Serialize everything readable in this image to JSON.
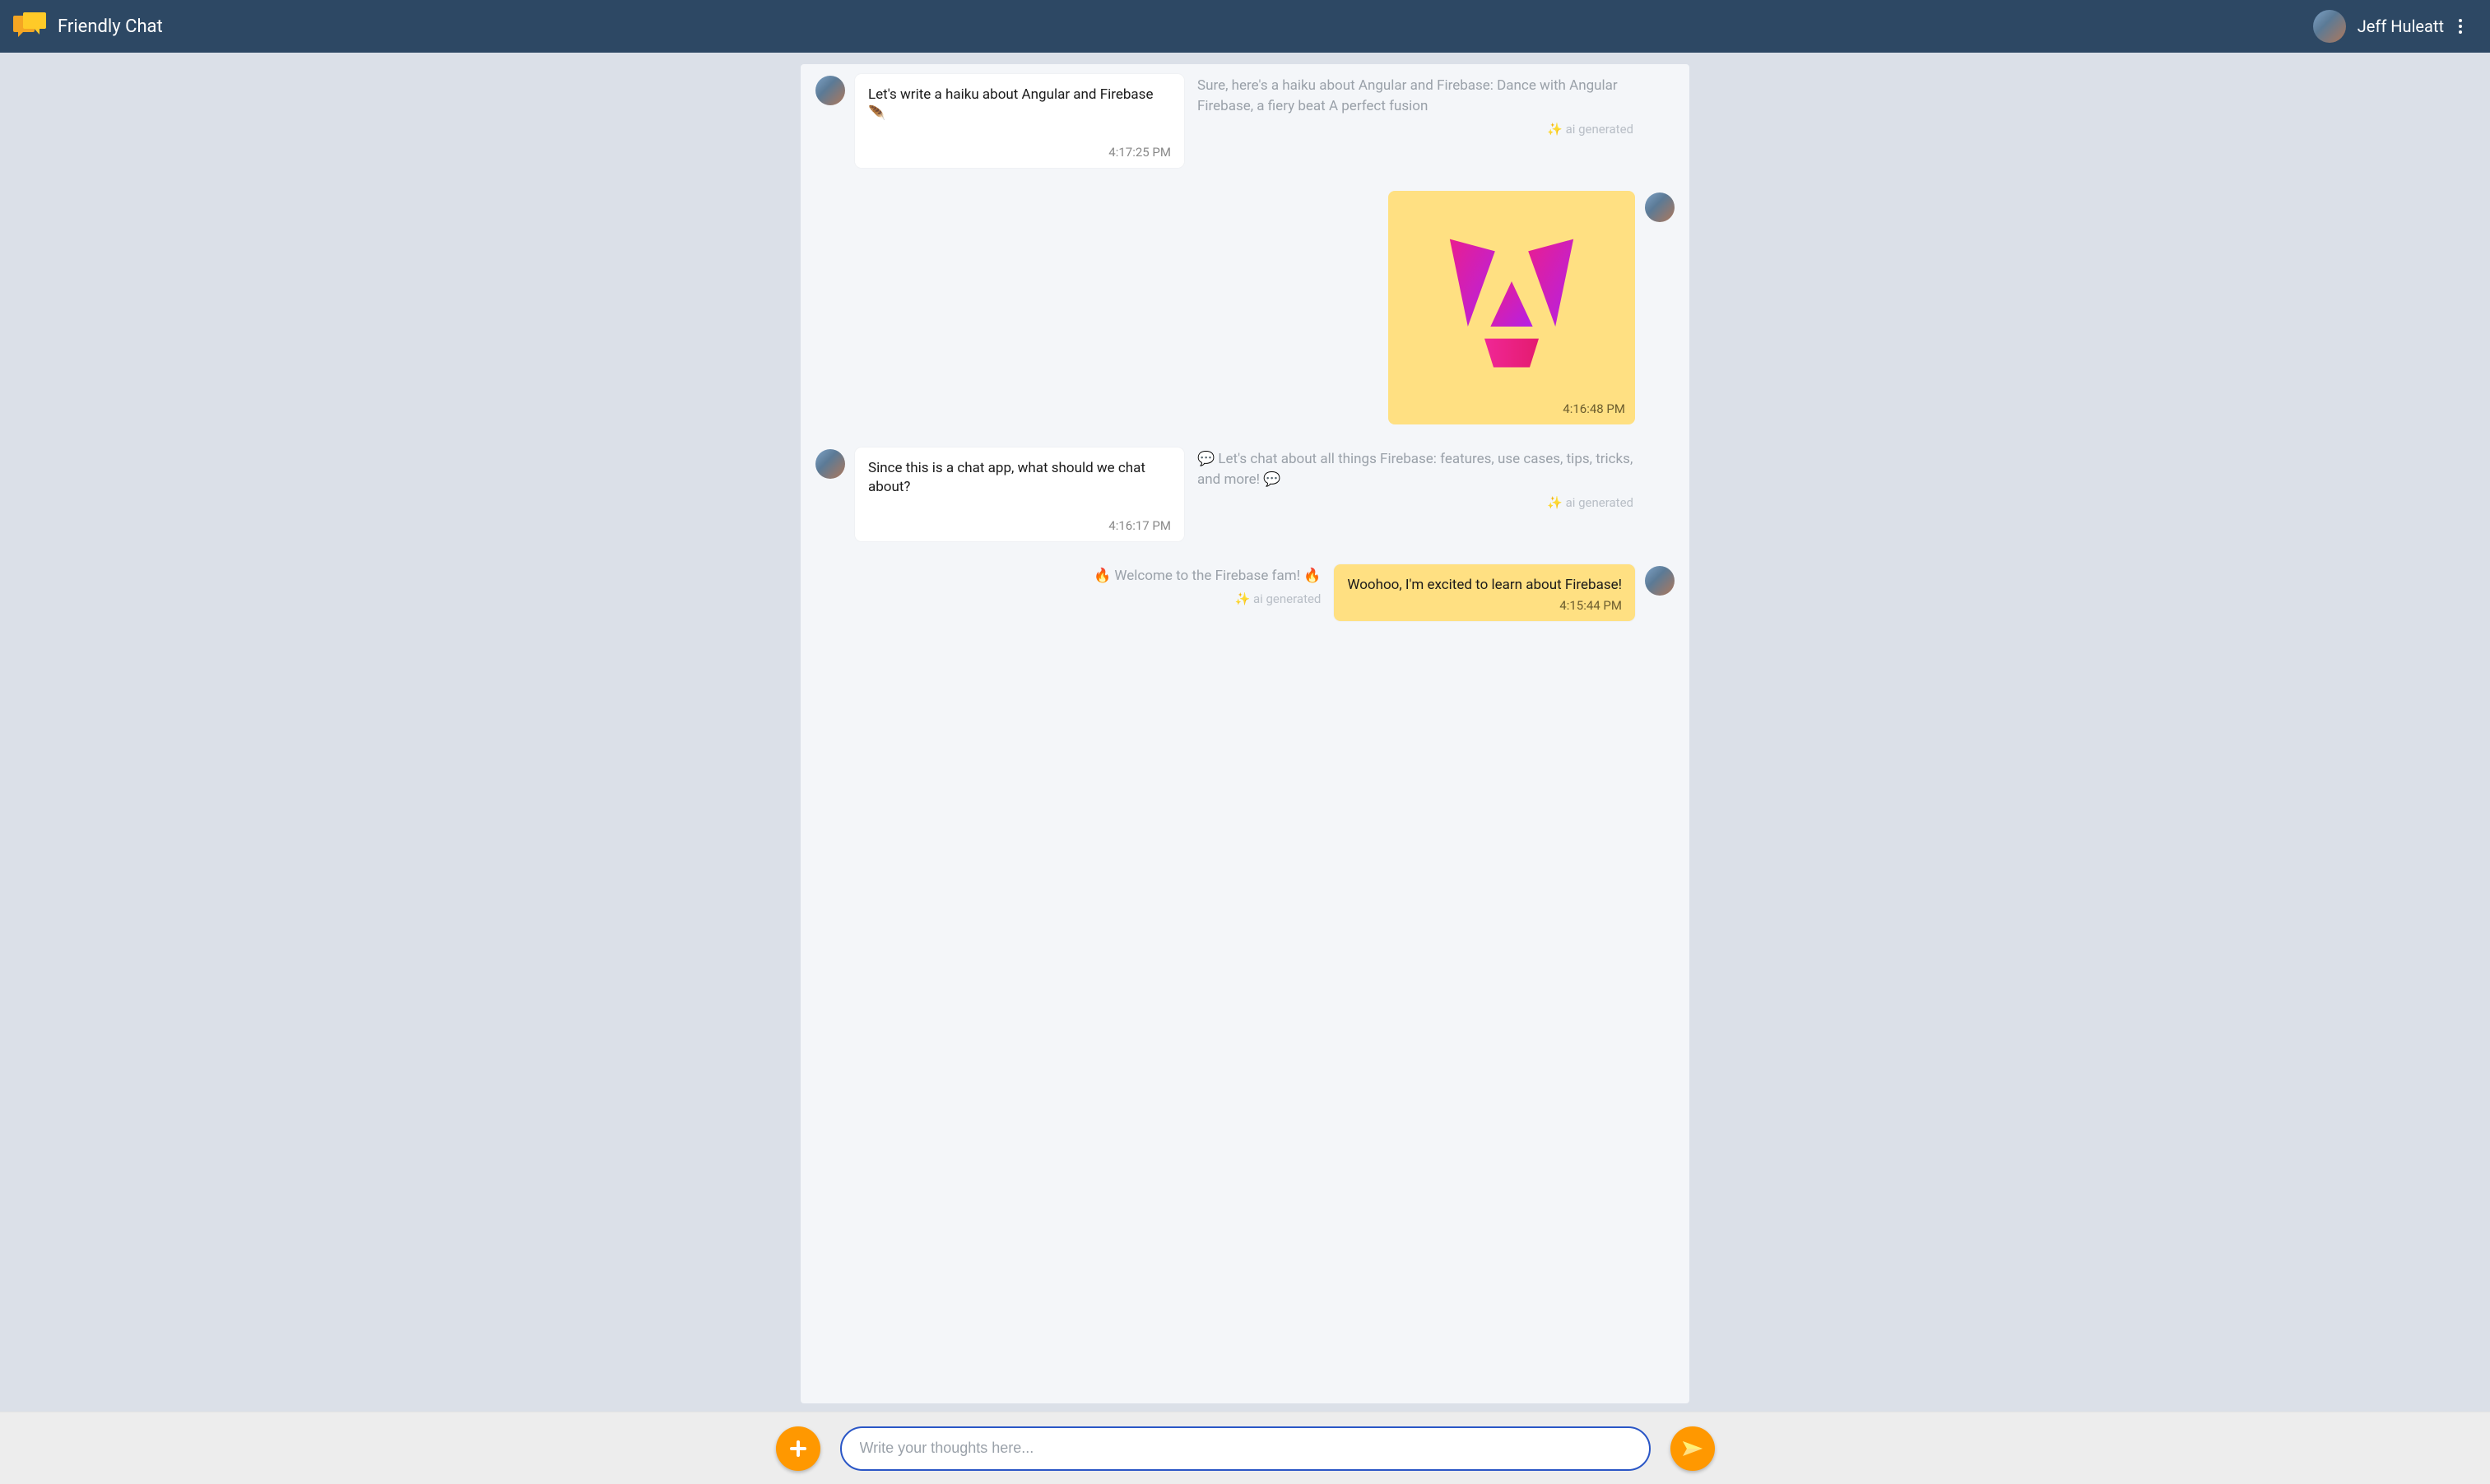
{
  "header": {
    "app_title": "Friendly Chat",
    "user_name": "Jeff Huleatt"
  },
  "messages": [
    {
      "side": "left",
      "bubble_text": "Let's write a haiku about Angular and Firebase 🪶",
      "bubble_time": "4:17:25 PM",
      "ai_text": "Sure, here's a haiku about Angular and Firebase: Dance with Angular Firebase, a fiery beat A perfect fusion",
      "ai_tag": "✨ ai generated"
    },
    {
      "side": "right",
      "type": "image",
      "bubble_time": "4:16:48 PM"
    },
    {
      "side": "left",
      "bubble_text": "Since this is a chat app, what should we chat about?",
      "bubble_time": "4:16:17 PM",
      "ai_text": "💬 Let's chat about all things Firebase: features, use cases, tips, tricks, and more! 💬",
      "ai_tag": "✨ ai generated"
    },
    {
      "side": "right",
      "bubble_text": "Woohoo, I'm excited to learn about Firebase!",
      "bubble_time": "4:15:44 PM",
      "ai_text": "🔥 Welcome to the Firebase fam! 🔥",
      "ai_tag": "✨ ai generated"
    }
  ],
  "composer": {
    "placeholder": "Write your thoughts here..."
  }
}
